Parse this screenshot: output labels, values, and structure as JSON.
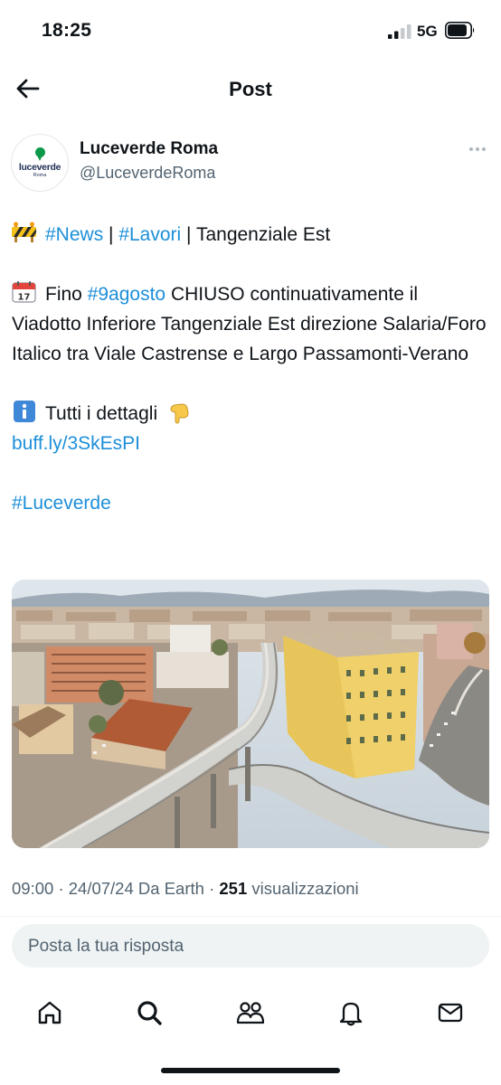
{
  "status_bar": {
    "time": "18:25",
    "network": "5G"
  },
  "header": {
    "title": "Post"
  },
  "author": {
    "name": "Luceverde Roma",
    "handle": "@LuceverdeRoma",
    "avatar_text": "luceverde",
    "avatar_subtext": "Roma"
  },
  "post": {
    "line1": {
      "news_tag": "#News",
      "sep1": " | ",
      "lavori_tag": "#Lavori",
      "rest": " | Tangenziale Est"
    },
    "line2": {
      "prefix": "Fino ",
      "date_tag": "#9agosto",
      "text": " CHIUSO continuativamente il Viadotto Inferiore Tangenziale Est direzione Salaria/Foro Italico tra Viale Castrense e Largo Passamonti-Verano"
    },
    "line3": {
      "text": "Tutti i dettagli"
    },
    "link": "buff.ly/3SkEsPI",
    "hashtag": "#Luceverde"
  },
  "meta": {
    "time": "09:00",
    "date": "24/07/24",
    "source": "Da Earth",
    "views_count": "251",
    "views_label": "visualizzazioni"
  },
  "reply": {
    "placeholder": "Posta la tua risposta"
  },
  "nav": [
    "home-icon",
    "search-icon",
    "communities-icon",
    "notifications-icon",
    "messages-icon"
  ],
  "colors": {
    "accent": "#1d8fd9",
    "text": "#0f1419",
    "muted": "#536471",
    "brand_green": "#0c9a4a"
  }
}
